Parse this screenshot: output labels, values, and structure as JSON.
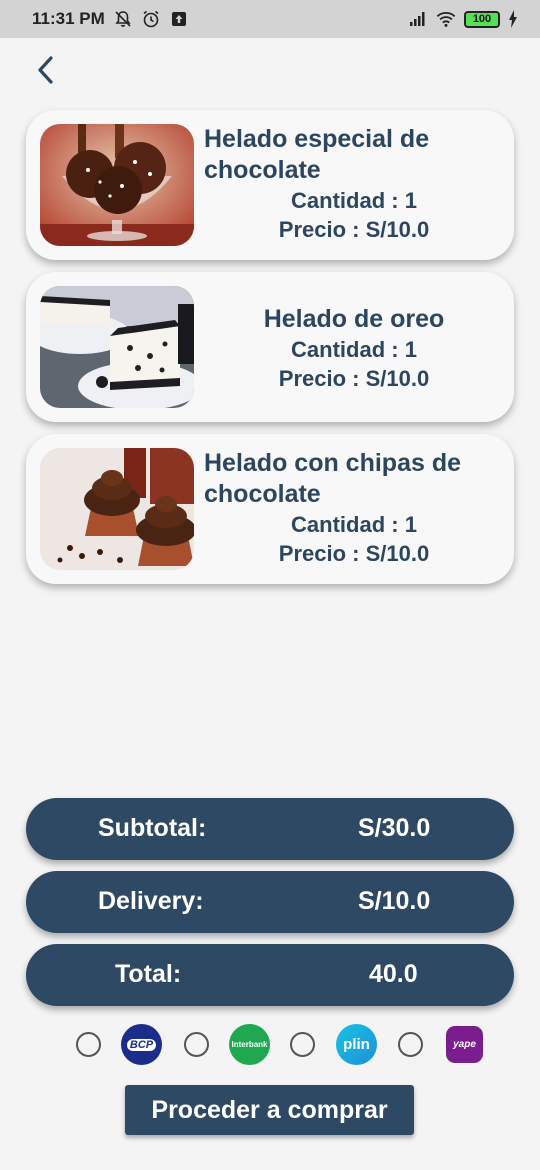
{
  "status_bar": {
    "time": "11:31 PM",
    "battery": "100"
  },
  "cart": [
    {
      "name": "Helado especial de chocolate",
      "quantity": "Cantidad : 1",
      "price": "Precio : S/10.0",
      "image": "chocolate-ice-cream-photo"
    },
    {
      "name": "Helado de oreo",
      "quantity": "Cantidad : 1",
      "price": "Precio : S/10.0",
      "image": "oreo-cheesecake-photo"
    },
    {
      "name": "Helado con chipas de chocolate",
      "quantity": "Cantidad : 1",
      "price": "Precio : S/10.0",
      "image": "chocolate-cupcakes-photo"
    }
  ],
  "summary": {
    "subtotal_label": "Subtotal:",
    "subtotal_value": "S/30.0",
    "delivery_label": "Delivery:",
    "delivery_value": "S/10.0",
    "total_label": "Total:",
    "total_value": "40.0"
  },
  "payment_methods": [
    {
      "label": "BCP",
      "color": "#1b2d8a"
    },
    {
      "label": "Interbank",
      "color": "#1fa84f"
    },
    {
      "label": "plin",
      "color": "#19c3e6"
    },
    {
      "label": "yape",
      "color": "#7b1d8f"
    }
  ],
  "buy_button": "Proceder a comprar",
  "colors": {
    "accent": "#2d4964",
    "text": "#2d4660",
    "background": "#f4f4f4"
  }
}
